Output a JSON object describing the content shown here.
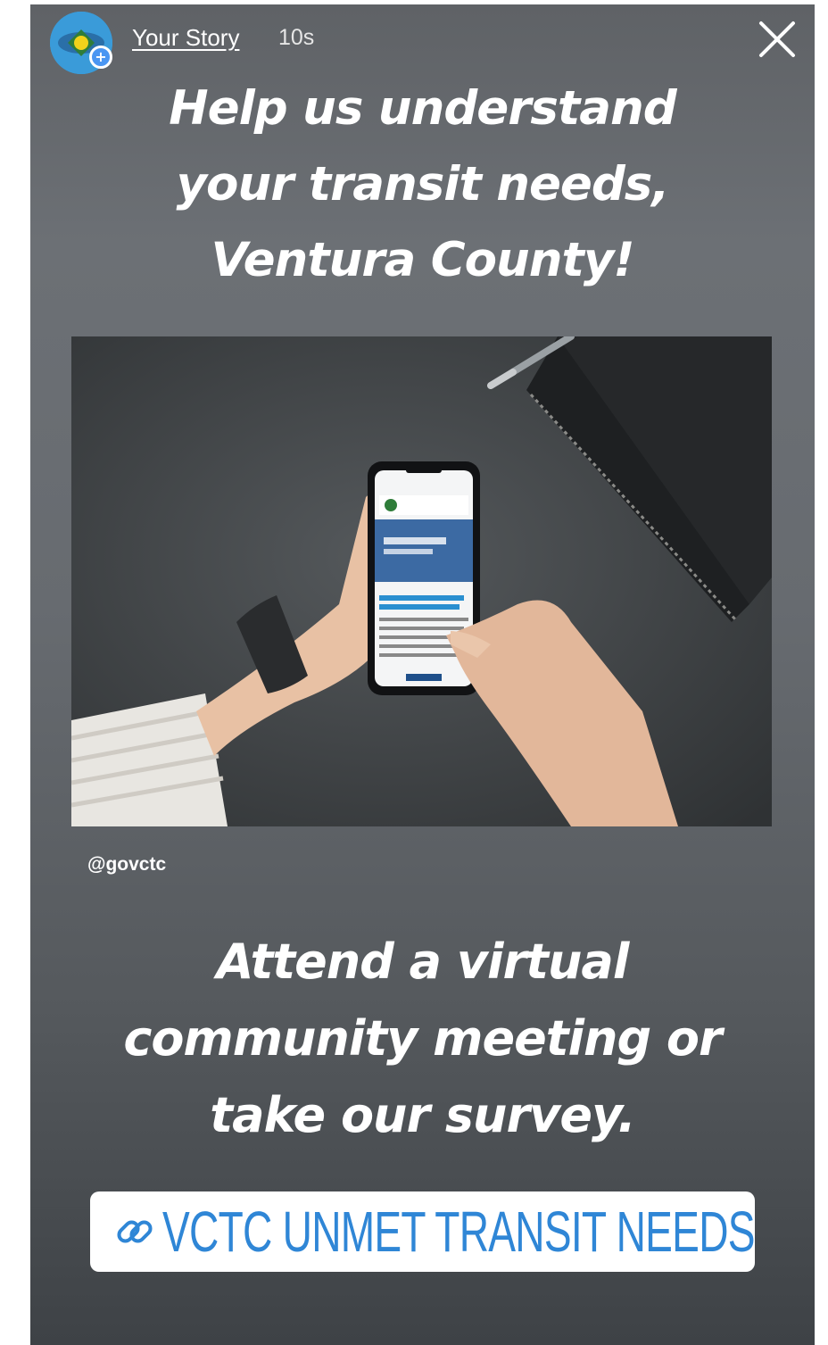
{
  "story": {
    "user": "Your Story",
    "time": "10s",
    "close_icon": "close-icon",
    "avatar_icon": "vctc-logo-icon"
  },
  "headline": {
    "line1": "Help us understand",
    "line2": "your transit needs,",
    "line3": "Ventura County!"
  },
  "photo": {
    "handle": "@govctc"
  },
  "cta": {
    "line1": "Attend a virtual",
    "line2": "community meeting or",
    "line3": "take our survey."
  },
  "link_sticker": {
    "icon": "link-icon",
    "label": "VCTC UNMET TRANSIT NEEDS",
    "color": "#2f86d6"
  }
}
